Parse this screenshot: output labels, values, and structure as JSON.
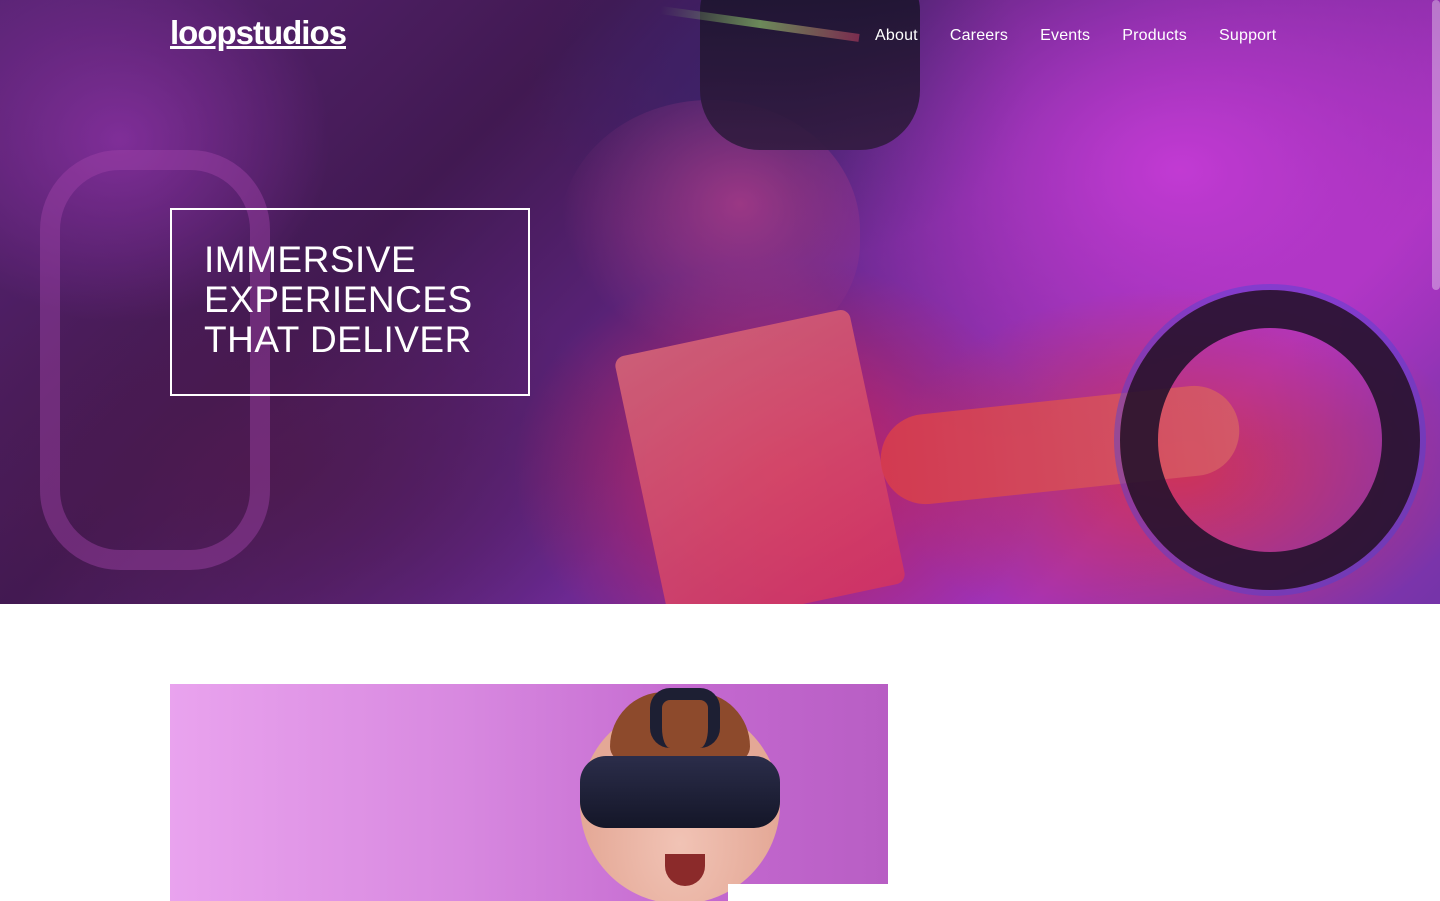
{
  "brand": {
    "logo_text": "loopstudios"
  },
  "nav": {
    "items": [
      {
        "label": "About"
      },
      {
        "label": "Careers"
      },
      {
        "label": "Events"
      },
      {
        "label": "Products"
      },
      {
        "label": "Support"
      }
    ]
  },
  "hero": {
    "title": "Immersive experiences that deliver"
  },
  "colors": {
    "hero_text": "#ffffff",
    "page_background": "#ffffff"
  }
}
